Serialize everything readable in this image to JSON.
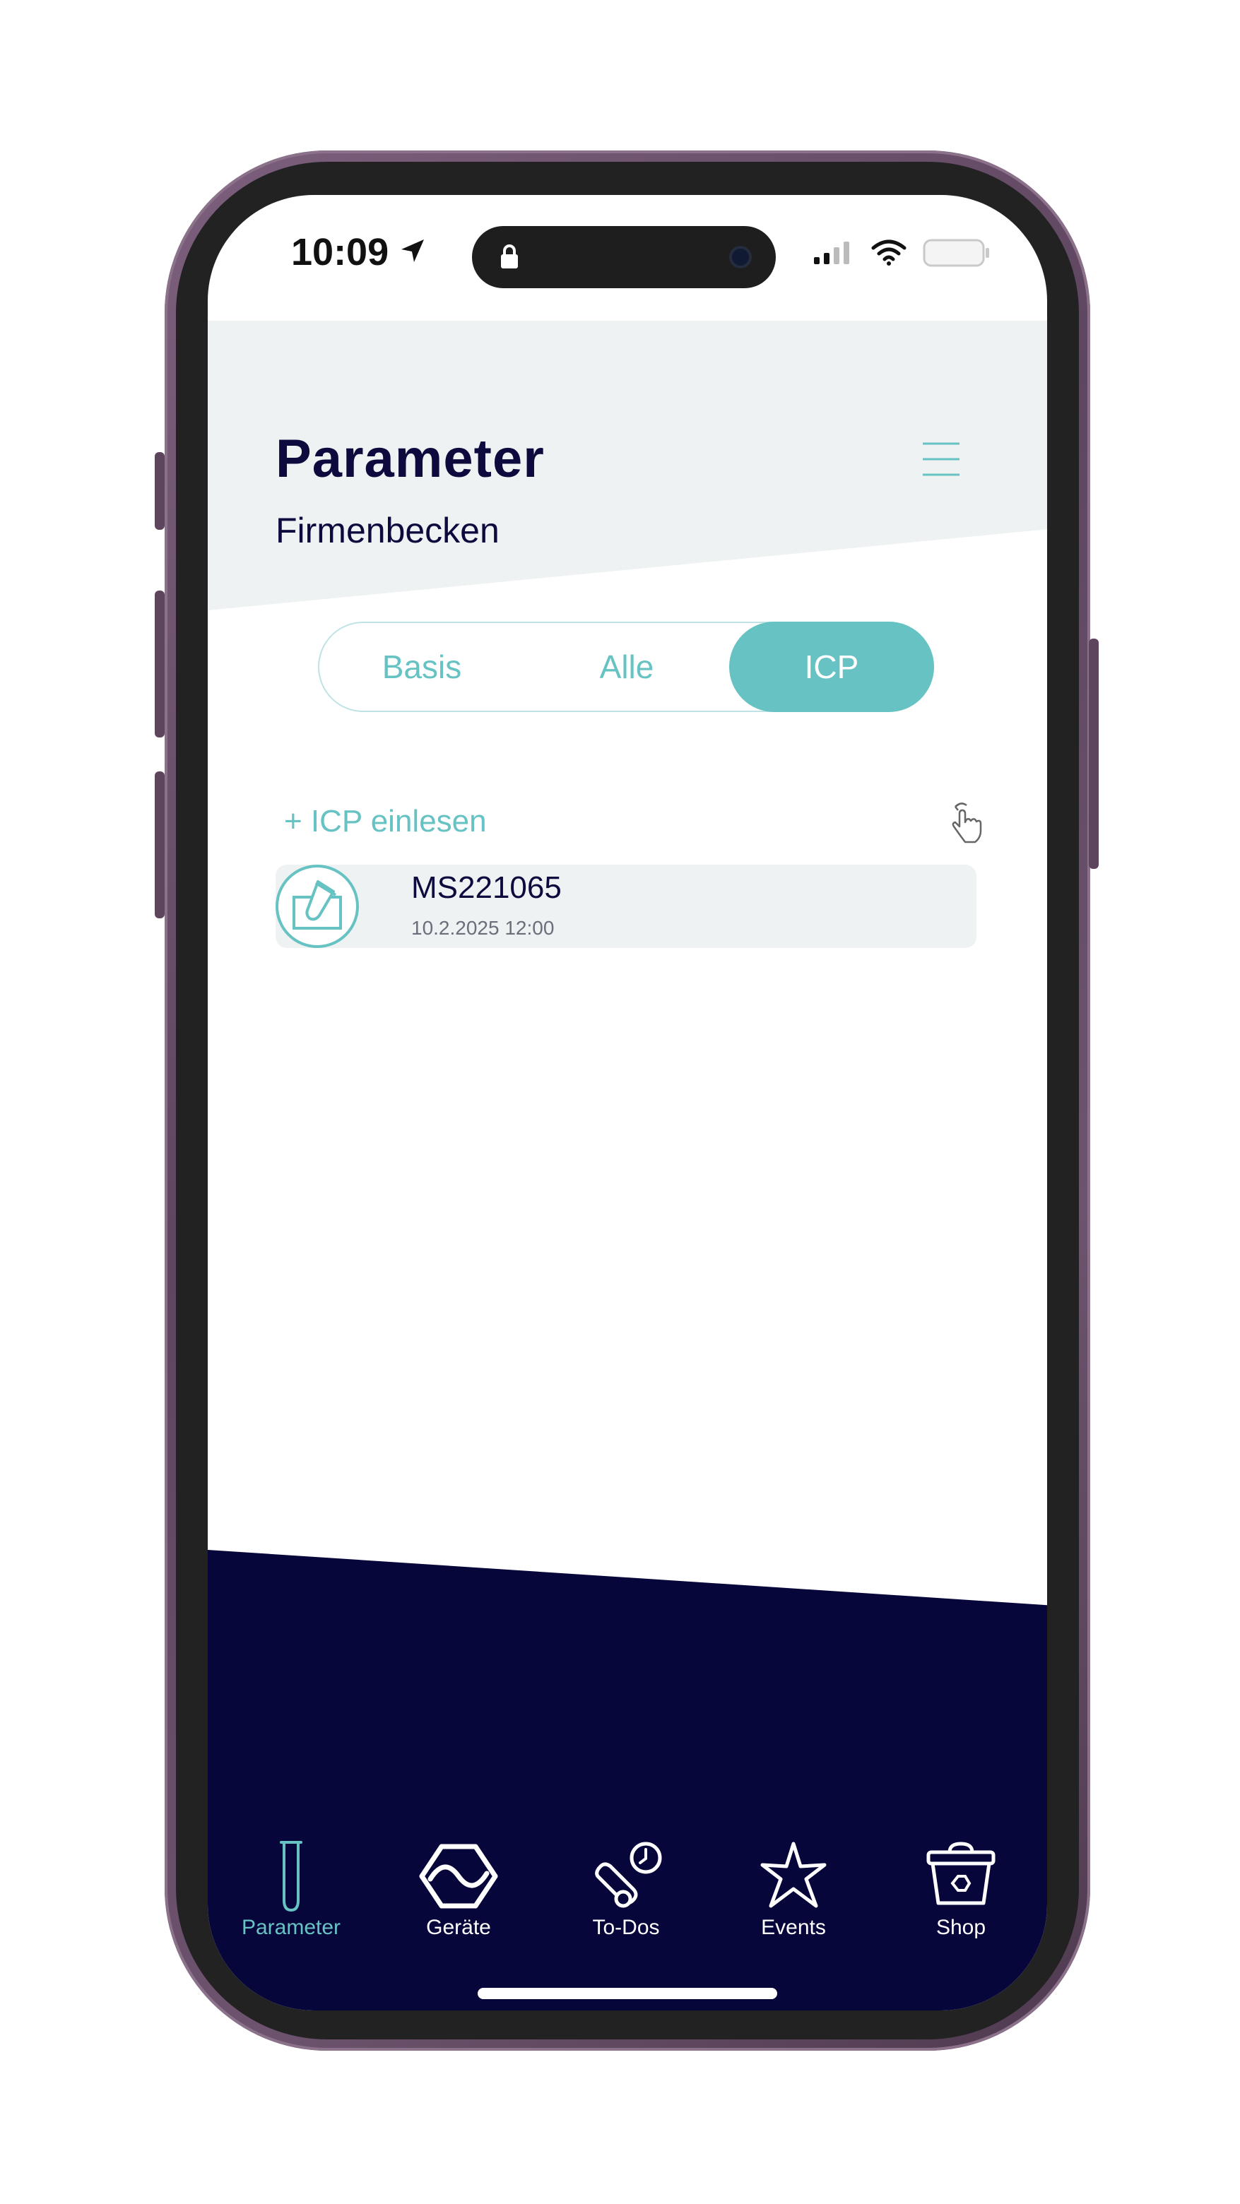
{
  "status_bar": {
    "time": "10:09",
    "icons": [
      "location-arrow-icon",
      "lock-icon",
      "camera-icon",
      "signal-icon",
      "wifi-icon",
      "battery-icon"
    ]
  },
  "header": {
    "title": "Parameter",
    "subtitle": "Firmenbecken",
    "menu_icon": "hamburger-menu-icon"
  },
  "tabs": [
    {
      "label": "Basis",
      "active": false
    },
    {
      "label": "Alle",
      "active": false
    },
    {
      "label": "ICP",
      "active": true
    }
  ],
  "icp": {
    "add_label": "+ ICP einlesen",
    "swipe_icon": "swipe-hand-icon",
    "items": [
      {
        "title": "MS221065",
        "date": "10.2.2025 12:00",
        "icon": "test-tube-icon"
      }
    ]
  },
  "bottom_nav": [
    {
      "label": "Parameter",
      "icon": "test-tube-icon",
      "active": true
    },
    {
      "label": "Geräte",
      "icon": "device-hexagon-icon",
      "active": false
    },
    {
      "label": "To-Dos",
      "icon": "todo-clock-icon",
      "active": false
    },
    {
      "label": "Events",
      "icon": "starfish-icon",
      "active": false
    },
    {
      "label": "Shop",
      "icon": "shop-basket-icon",
      "active": false
    }
  ],
  "colors": {
    "accent": "#67c2c3",
    "navy": "#07063a",
    "header_bg": "#eef2f3",
    "title": "#0d0b3e",
    "phone_frame": "#6a4f6a"
  }
}
